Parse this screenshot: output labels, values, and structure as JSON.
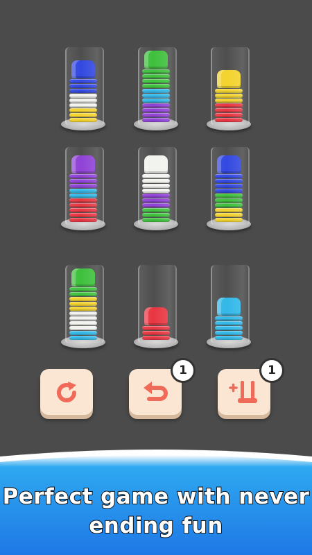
{
  "colors": {
    "blue": "#2f45e0",
    "white": "#f2f2ee",
    "yellow": "#f2d22a",
    "green": "#3cbf3a",
    "cyan": "#2fb7e8",
    "purple": "#8e3fd6",
    "red": "#e8333f",
    "background": "#4b4b4b",
    "button": "#fae6d2",
    "icon": "#f06a5a"
  },
  "tubes": [
    {
      "cups": [
        "yellow",
        "yellow",
        "yellow",
        "white",
        "white",
        "white",
        "blue",
        "blue",
        "blue",
        "blue"
      ]
    },
    {
      "cups": [
        "purple",
        "purple",
        "purple",
        "purple",
        "cyan",
        "cyan",
        "cyan",
        "green",
        "green",
        "green",
        "green",
        "green"
      ]
    },
    {
      "cups": [
        "red",
        "red",
        "red",
        "red",
        "yellow",
        "yellow",
        "yellow",
        "yellow"
      ]
    },
    {
      "cups": [
        "red",
        "red",
        "red",
        "red",
        "red",
        "cyan",
        "cyan",
        "purple",
        "purple",
        "purple",
        "purple"
      ]
    },
    {
      "cups": [
        "green",
        "green",
        "green",
        "purple",
        "purple",
        "purple",
        "white",
        "white",
        "white",
        "white",
        "white"
      ]
    },
    {
      "cups": [
        "yellow",
        "yellow",
        "yellow",
        "green",
        "green",
        "green",
        "blue",
        "blue",
        "blue",
        "blue",
        "blue"
      ]
    },
    {
      "cups": [
        "cyan",
        "cyan",
        "white",
        "white",
        "white",
        "white",
        "yellow",
        "yellow",
        "yellow",
        "green",
        "green",
        "green"
      ]
    },
    {
      "cups": [
        "red",
        "red",
        "red",
        "red"
      ]
    },
    {
      "cups": [
        "cyan",
        "cyan",
        "cyan",
        "cyan",
        "cyan",
        "cyan"
      ]
    }
  ],
  "buttons": {
    "restart": {
      "icon": "restart-icon"
    },
    "undo": {
      "icon": "undo-icon",
      "count": "1"
    },
    "add_tube": {
      "icon": "add-tube-icon",
      "count": "1"
    }
  },
  "banner": {
    "line1": "Perfect game with never",
    "line2": "ending fun"
  }
}
